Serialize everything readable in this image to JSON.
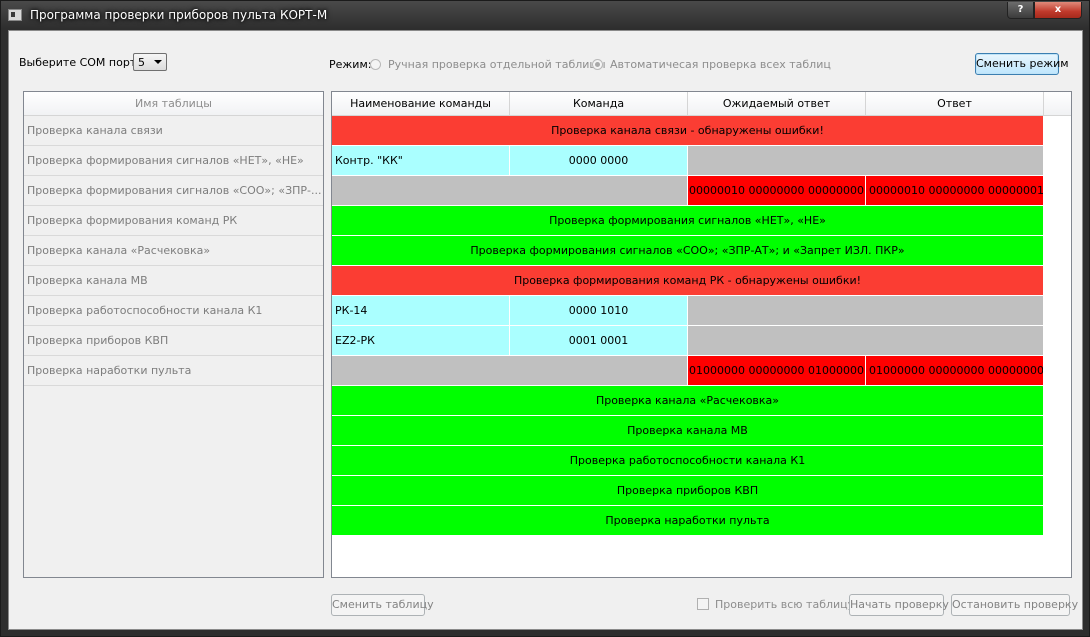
{
  "window": {
    "title": "Программа проверки приборов пульта КОРТ-М",
    "help_label": "?",
    "close_label": "x"
  },
  "toolbar": {
    "com_label": "Выберите COM порт:",
    "com_value": "5",
    "mode_label": "Режим:",
    "mode_manual": "Ручная проверка отдельной таблицы",
    "mode_auto": "Автоматичесая проверка всех таблиц",
    "change_mode": "Сменить режим"
  },
  "tables_panel": {
    "header": "Имя таблицы",
    "items": [
      "Проверка канала связи",
      "Проверка формирования сигналов «НЕТ», «НЕ»",
      "Проверка формирования сигналов «СОО»; «ЗПР-...",
      "Проверка формирования команд РК",
      "Проверка канала «Расчековка»",
      "Проверка канала МВ",
      "Проверка работоспособности канала К1",
      "Проверка приборов КВП",
      "Проверка наработки пульта"
    ]
  },
  "grid": {
    "columns": [
      "Наименование команды",
      "Команда",
      "Ожидаемый ответ",
      "Ответ"
    ],
    "rows": [
      {
        "type": "section",
        "status": "error",
        "text": "Проверка канала связи - обнаружены ошибки!"
      },
      {
        "type": "command",
        "name": "Контр. \"КК\"",
        "command": "0000 0000"
      },
      {
        "type": "result",
        "expected": "00000010  00000000  00000000",
        "answer": "00000010  00000000  00000001"
      },
      {
        "type": "section",
        "status": "ok",
        "text": "Проверка формирования сигналов «НЕТ», «НЕ»"
      },
      {
        "type": "section",
        "status": "ok",
        "text": "Проверка формирования сигналов «СОО»; «ЗПР-АТ»; и «Запрет ИЗЛ. ПКР»"
      },
      {
        "type": "section",
        "status": "error",
        "text": "Проверка формирования команд РК - обнаружены ошибки!"
      },
      {
        "type": "command",
        "name": "РК-14",
        "command": "0000 1010"
      },
      {
        "type": "command",
        "name": "EZ2-РК",
        "command": "0001 0001"
      },
      {
        "type": "result",
        "expected": "01000000  00000000  01000000",
        "answer": "01000000  00000000  00000000"
      },
      {
        "type": "section",
        "status": "ok",
        "text": "Проверка канала «Расчековка»"
      },
      {
        "type": "section",
        "status": "ok",
        "text": "Проверка канала МВ"
      },
      {
        "type": "section",
        "status": "ok",
        "text": "Проверка работоспособности канала К1"
      },
      {
        "type": "section",
        "status": "ok",
        "text": "Проверка приборов КВП"
      },
      {
        "type": "section",
        "status": "ok",
        "text": "Проверка наработки пульта"
      }
    ]
  },
  "bottom": {
    "change_table": "Сменить таблицу",
    "check_all": "Проверить всю таблицу",
    "start": "Начать проверку",
    "stop": "Остановить проверку"
  },
  "colors": {
    "error": "#fb3d33",
    "ok": "#00ff00",
    "command": "#aaffff",
    "empty": "#c0c0c0",
    "mismatch": "#ff0000"
  }
}
